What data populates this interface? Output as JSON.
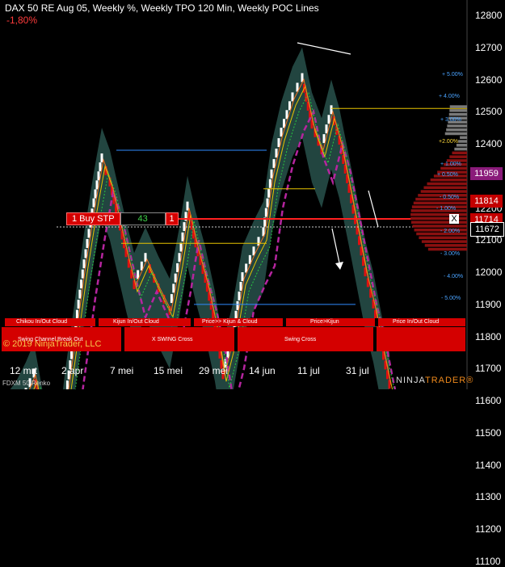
{
  "header": {
    "title": "DAX 50 RE Aug 05, Weekly %, Weekly TPO 120 Min, Weekly POC Lines",
    "change": "-1,80%"
  },
  "price_axis": {
    "labels": [
      "12800",
      "12700",
      "12600",
      "12500",
      "12400",
      "12300",
      "12200",
      "12100",
      "12000",
      "11900",
      "11800",
      "11700",
      "11600",
      "11500",
      "11400",
      "11300",
      "11200",
      "11100"
    ]
  },
  "price_tags": [
    {
      "value": "11959",
      "color": "#8a1b7a"
    },
    {
      "value": "11814",
      "color": "#c30000"
    },
    {
      "value": "11714",
      "color": "#c30000"
    },
    {
      "value": "11672",
      "color": "#000000"
    }
  ],
  "pct_labels": [
    "+ 5.00%",
    "+ 4.00%",
    "+ 3.00%",
    "+2.00%",
    "+ 1.00%",
    "+ 0.50%",
    "- 0.50%",
    "- 1.00%",
    "- 2.00%",
    "- 3.00%",
    "- 4.00%",
    "- 5.00%"
  ],
  "date_axis": {
    "labels": [
      "12 mrt",
      "2 apr",
      "7 mei",
      "15 mei",
      "29 mei",
      "14 jun",
      "11 jul",
      "31 jul"
    ]
  },
  "order": {
    "action": "1 Buy STP",
    "quantity": "43",
    "count": "1",
    "close": "X"
  },
  "panels": {
    "row1": [
      "Chikou In/Out Cloud",
      "Kijun In/Out Cloud",
      "Price>> Kijun & Cloud",
      "Price>Kijun",
      "Price In/Out Cloud"
    ],
    "row2": [
      "Swing Channel Break Out",
      "X SWING Cross",
      "Swing Cross"
    ]
  },
  "copyright": "© 2019 NinjaTrader, LLC",
  "footer": {
    "instrument": "FDXM 50 Renko",
    "brand_left": "NINJA",
    "brand_right": "TRADER®"
  },
  "colors": {
    "up": "#ffffff",
    "down": "#e01010",
    "cloud": "#2e5c55",
    "sma": "#b5259f",
    "sell": "#d60000"
  }
}
